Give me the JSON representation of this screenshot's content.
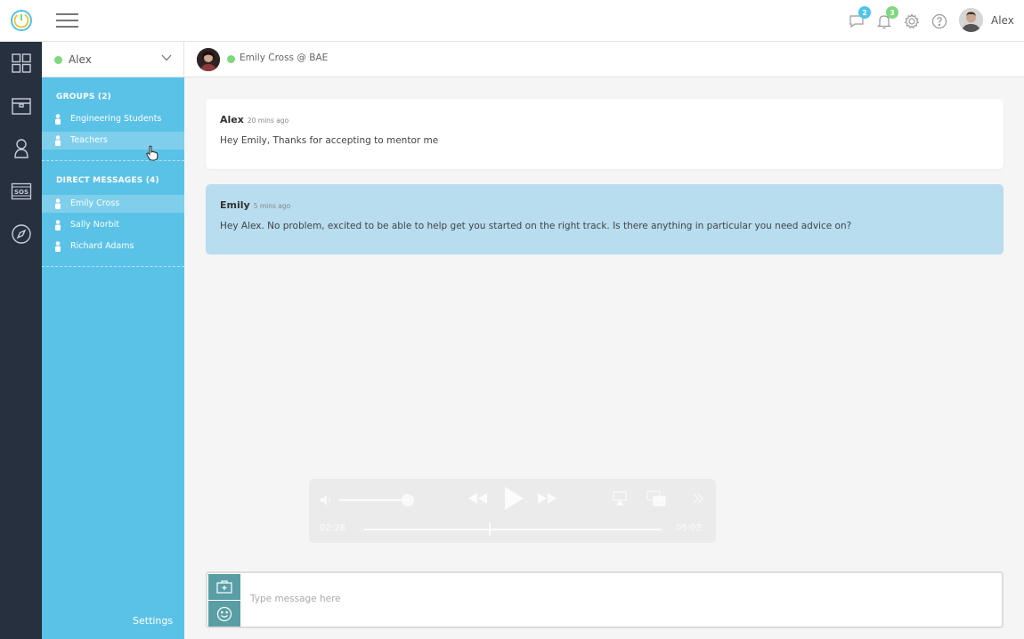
{
  "header": {
    "user_name": "Alex",
    "messages_badge": "2",
    "notifications_badge": "3",
    "badge_colors": {
      "messages": "#4fc3e8",
      "notifications": "#7ed87e"
    }
  },
  "rail": {
    "icons": [
      "dashboard-icon",
      "briefcase-icon",
      "person-icon",
      "sos-icon",
      "compass-icon"
    ]
  },
  "sidebar": {
    "current_user": "Alex",
    "groups_title": "GROUPS (2)",
    "groups": [
      {
        "label": "Engineering Students"
      },
      {
        "label": "Teachers"
      }
    ],
    "dm_title": "DIRECT MESSAGES (4)",
    "direct_messages": [
      {
        "label": "Emily Cross"
      },
      {
        "label": "Sally Norbit"
      },
      {
        "label": "Richard Adams"
      }
    ],
    "settings_label": "Settings"
  },
  "chat": {
    "contact": "Emily Cross @ BAE",
    "messages": [
      {
        "author": "Alex",
        "time": "20 mins ago",
        "text": "Hey Emily, Thanks for accepting to mentor me"
      },
      {
        "author": "Emily",
        "time": "5 mins ago",
        "text": "Hey Alex. No problem, excited to be able to help get you started on the right track. Is there anything in particular you need advice on?"
      }
    ]
  },
  "video": {
    "current_time": "02:28",
    "duration": "05:02",
    "progress": 0.42,
    "volume": 0.85
  },
  "composer": {
    "placeholder": "Type message here"
  },
  "colors": {
    "rail": "#27303f",
    "sidebar": "#5bc2e7",
    "received_bubble": "#b7ddef",
    "composer_button": "#5a9ea5",
    "online": "#7ed87e"
  }
}
